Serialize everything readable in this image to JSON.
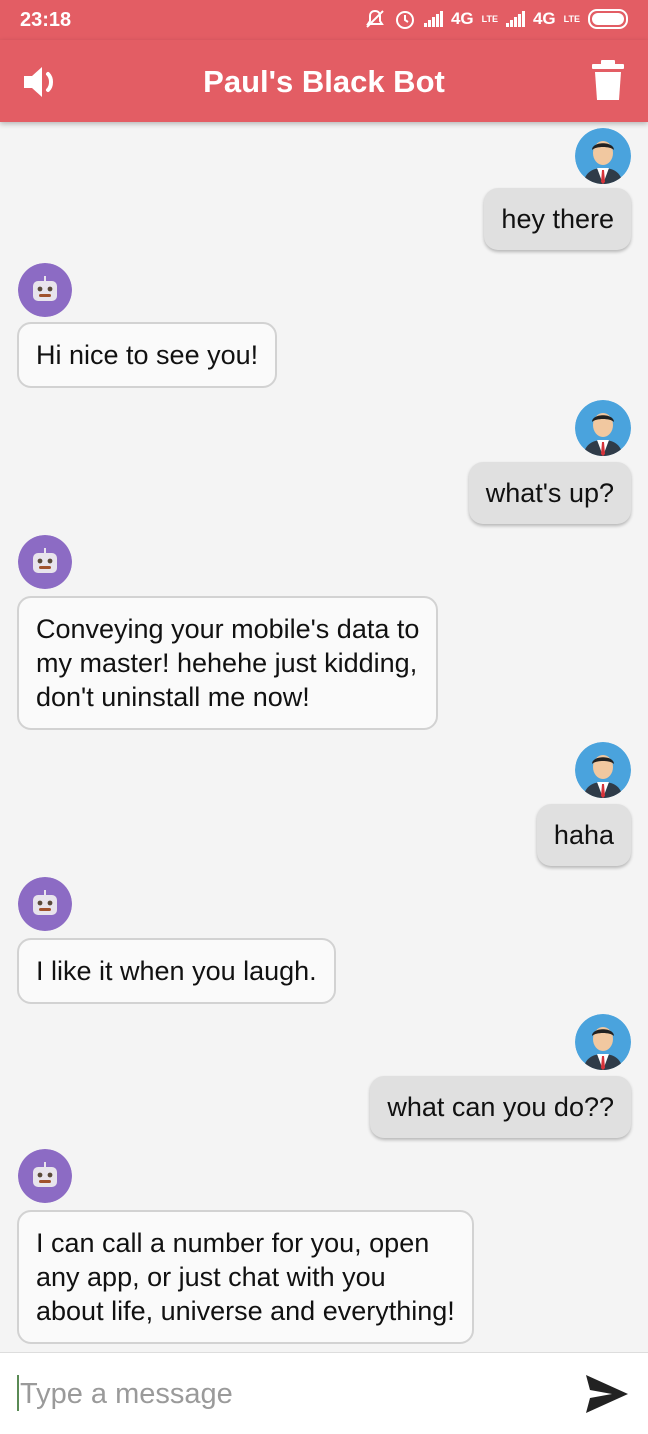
{
  "status_bar": {
    "time": "23:18",
    "network_1": "4G",
    "lte_1": "LTE",
    "network_2": "4G",
    "lte_2": "LTE",
    "icons": [
      "mute-icon",
      "alarm-icon",
      "signal-icon",
      "signal-icon",
      "battery-icon"
    ]
  },
  "app_bar": {
    "title": "Paul's Black Bot",
    "left_icon": "speaker-icon",
    "right_icon": "trash-icon"
  },
  "messages": [
    {
      "sender": "user",
      "text": "hey there"
    },
    {
      "sender": "bot",
      "text": "Hi nice to see you!"
    },
    {
      "sender": "user",
      "text": "what's up?"
    },
    {
      "sender": "bot",
      "lines": [
        "Conveying your mobile's data to",
        "my master! hehehe just kidding,",
        "don't uninstall me now!"
      ]
    },
    {
      "sender": "user",
      "text": "haha"
    },
    {
      "sender": "bot",
      "text": "I like it when you laugh."
    },
    {
      "sender": "user",
      "text": "what can you do??"
    },
    {
      "sender": "bot",
      "lines": [
        "I can call a number for you, open",
        "any app, or just chat with you",
        "about life, universe and everything!"
      ]
    }
  ],
  "composer": {
    "placeholder": "Type a message",
    "value": "",
    "send_icon": "send-icon"
  },
  "colors": {
    "accent": "#e35d64",
    "user_bubble": "#e0e0e0",
    "bot_bubble": "#fafafa",
    "bot_avatar": "#8c6bc4",
    "user_avatar": "#4aa3dd"
  }
}
